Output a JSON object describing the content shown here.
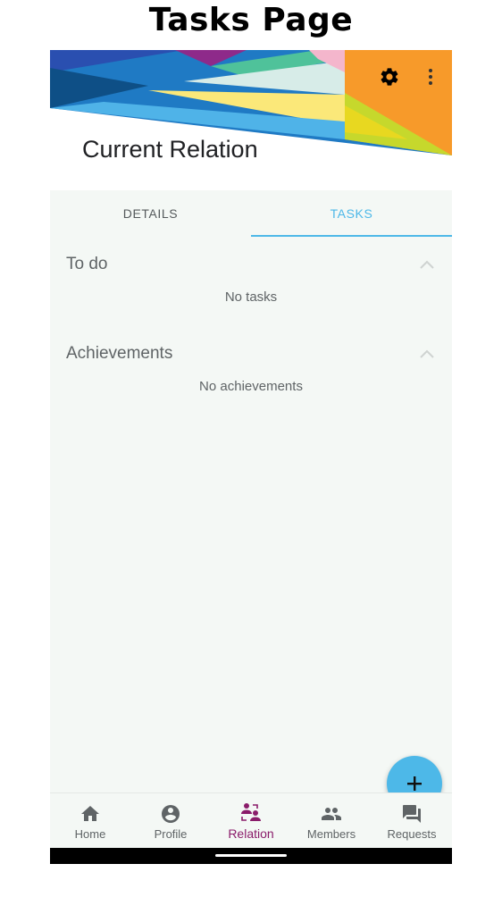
{
  "page_title": "Tasks Page",
  "header": {
    "title": "Current Relation",
    "settings_icon": "gear-icon",
    "menu_icon": "more-vertical-icon"
  },
  "tabs": [
    {
      "label": "DETAILS",
      "active": false
    },
    {
      "label": "TASKS",
      "active": true
    }
  ],
  "sections": {
    "todo": {
      "title": "To do",
      "empty_text": "No tasks"
    },
    "achievements": {
      "title": "Achievements",
      "empty_text": "No achievements"
    }
  },
  "fab": {
    "icon": "plus-icon"
  },
  "bottom_nav": [
    {
      "label": "Home",
      "icon": "home-icon",
      "active": false
    },
    {
      "label": "Profile",
      "icon": "account-circle-icon",
      "active": false
    },
    {
      "label": "Relation",
      "icon": "relation-icon",
      "active": true
    },
    {
      "label": "Members",
      "icon": "people-icon",
      "active": false
    },
    {
      "label": "Requests",
      "icon": "chat-icon",
      "active": false
    }
  ],
  "colors": {
    "accent": "#4db8e8",
    "active_nav": "#8a1c6a",
    "background": "#f4f8f5"
  }
}
